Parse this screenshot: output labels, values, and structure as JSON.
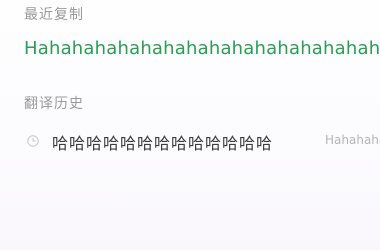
{
  "recent": {
    "label": "最近复制",
    "text": "Hahahahahahahahahahahahahahahahahahaha"
  },
  "history": {
    "label": "翻译历史",
    "items": [
      {
        "icon": "clock-icon",
        "source": "哈哈哈哈哈哈哈哈哈哈哈哈哈",
        "translation": "Hahahahahahahaha"
      }
    ]
  },
  "colors": {
    "accent": "#2a9d56",
    "label": "#9a9a9a",
    "text": "#3c3c3c",
    "muted": "#b5b5b5"
  }
}
